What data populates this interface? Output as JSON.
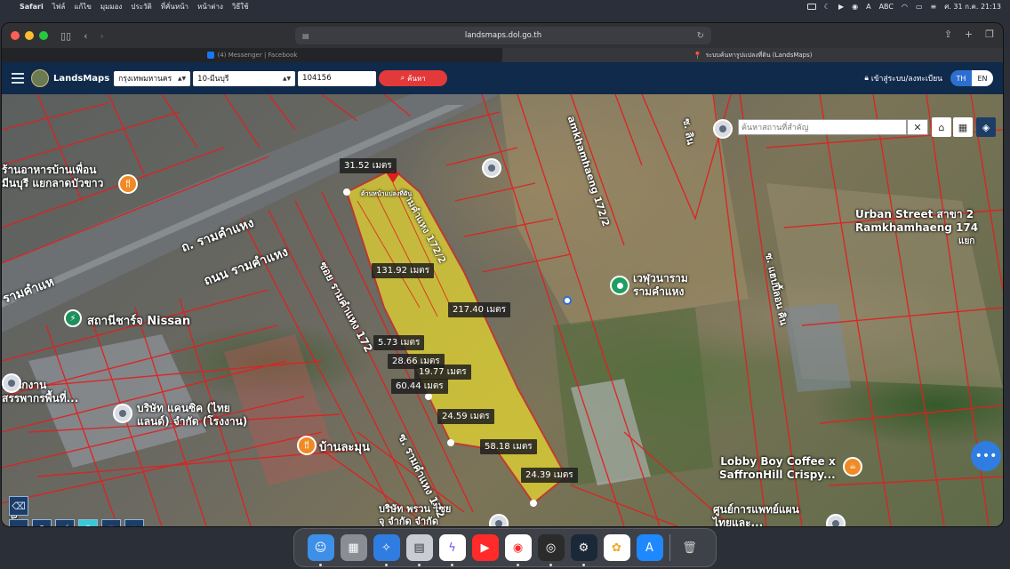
{
  "menubar": {
    "app": "Safari",
    "items": [
      "ไฟล์",
      "แก้ไข",
      "มุมมอง",
      "ประวัติ",
      "ที่คั่นหน้า",
      "หน้าต่าง",
      "วิธีใช้"
    ],
    "input_source": "ABC",
    "datetime": "ศ. 31 ก.ค.  21:13"
  },
  "browser": {
    "url": "landsmaps.dol.go.th",
    "tabs": [
      {
        "title": "(4) Messenger | Facebook",
        "active": false
      },
      {
        "title": "ระบบค้นหารูปแปลงที่ดิน (LandsMaps)",
        "active": true
      }
    ]
  },
  "site": {
    "brand": "LandsMaps",
    "province": "กรุงเทพมหานคร",
    "district": "10-มีนบุรี",
    "parcel_number": "104156",
    "search_label": "ค้นหา",
    "login_label": "เข้าสู่ระบบ/ลงทะเบียน",
    "lang_th": "TH",
    "lang_en": "EN"
  },
  "map": {
    "search_placeholder": "ค้นหาสถานที่สำคัญ",
    "road_labels": {
      "road1": "ถ. รามคำแหง",
      "road2": "ถนน รามคำแหง",
      "road3": "รามคำแห",
      "soi1": "ซอย รามคำแหง 172",
      "soi2": "ซ. รามคำแหง 172",
      "soi3": "amkhamhaeng 172/2",
      "soi4": "ซ. แฮปปี้ลอน คิน",
      "soi5": "ซ. ลิน",
      "soi6": "ซอย ลิ",
      "soi7": "รามคำแหง 172/2",
      "parcel_note": "ด้านหน้าแปลงที่ดิน"
    },
    "places": {
      "restaurant1": "ร้านอาหารบ้านเพื่อน\nมีนบุรี แยกลาดบัวขาว",
      "nissan": "สถานีชาร์จ Nissan",
      "tax": "สำนักงาน\nสรรพากรพื้นที่...",
      "company1": "บริษัท แคนซิค (ไทย\nแลนด์) จำกัด (โรงงาน)",
      "banlamun": "บ้านละมุน",
      "temple": "เวฬุวนาราม\nรามคำแหง",
      "urban": "Urban Street สาขา 2\nRamkhamhaeng 174",
      "urban_extra": "แยก",
      "coffee": "Lobby Boy Coffee x\nSaffronHill Crispy...",
      "medical": "ศูนย์การแพทย์แผน\nไทยและ...",
      "company2": "บริษัท พรวน ไซย\nจุ จำกัด จำกัด"
    },
    "dimensions": [
      "31.52 เมตร",
      "131.92 เมตร",
      "217.40 เมตร",
      "5.73 เมตร",
      "28.66 เมตร",
      "19.77 เมตร",
      "60.44 เมตร",
      "24.59 เมตร",
      "58.18 เมตร",
      "24.39 เมตร"
    ],
    "colors": {
      "parcel_fill": "#f5e52a",
      "boundary": "#e02020",
      "header": "#0f2a4a",
      "search_button": "#e23a3a"
    }
  },
  "dock": [
    "finder",
    "launchpad",
    "safari",
    "preview",
    "messenger",
    "youtube",
    "youtube-music",
    "record",
    "steam",
    "photos",
    "app-store",
    "trash"
  ]
}
